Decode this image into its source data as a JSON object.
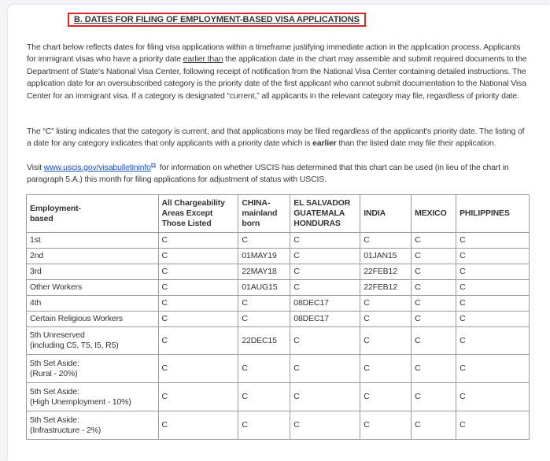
{
  "section_heading": "B.  DATES FOR FILING OF EMPLOYMENT-BASED VISA APPLICATIONS",
  "paragraph1": {
    "part1": "The chart below reflects dates for filing visa applications within a timeframe justifying immediate action in the application process. Applicants for immigrant visas who have a priority date ",
    "underlined": "earlier than",
    "part2": " the application date in the chart may assemble and submit required documents to the Department of State's National Visa Center, following receipt of notification from the National Visa Center containing detailed instructions. The application date for an oversubscribed category is the priority date of the first applicant who cannot submit documentation to the National Visa Center for an immigrant visa. If a category is designated “current,” all applicants in the relevant category may file, regardless of priority date."
  },
  "paragraph2": {
    "part1": "The “C” listing indicates that the category is current, and that applications may be filed regardless of the applicant's priority date. The listing of a date for any category indicates that only applicants with a priority date which is ",
    "bold": "earlier",
    "part2": " than the listed date may file their application."
  },
  "paragraph3": {
    "part1": "Visit ",
    "link": "www.uscis.gov/visabulletininfo",
    "part2": " for information on whether USCIS has determined that this chart can be used (in lieu of the chart in paragraph 5.A.) this month for filing applications for adjustment of status with USCIS."
  },
  "table": {
    "headers": [
      "Employment-\nbased",
      "All Chargeability\nAreas Except\nThose Listed",
      "CHINA-\nmainland\nborn",
      "EL SALVADOR\nGUATEMALA\nHONDURAS",
      "INDIA",
      "MEXICO",
      "PHILIPPINES"
    ],
    "rows": [
      [
        "1st",
        "C",
        "C",
        "C",
        "C",
        "C",
        "C"
      ],
      [
        "2nd",
        "C",
        "01MAY19",
        "C",
        "01JAN15",
        "C",
        "C"
      ],
      [
        "3rd",
        "C",
        "22MAY18",
        "C",
        "22FEB12",
        "C",
        "C"
      ],
      [
        "Other Workers",
        "C",
        "01AUG15",
        "C",
        "22FEB12",
        "C",
        "C"
      ],
      [
        "4th",
        "C",
        "C",
        "08DEC17",
        "C",
        "C",
        "C"
      ],
      [
        "Certain Religious Workers",
        "C",
        "C",
        "08DEC17",
        "C",
        "C",
        "C"
      ],
      [
        "5th Unreserved\n(including C5, T5, I5, R5)",
        "C",
        "22DEC15",
        "C",
        "C",
        "C",
        "C"
      ],
      [
        "5th Set Aside:\n(Rural - 20%)",
        "C",
        "C",
        "C",
        "C",
        "C",
        "C"
      ],
      [
        "5th Set Aside:\n(High Unemployment - 10%)",
        "C",
        "C",
        "C",
        "C",
        "C",
        "C"
      ],
      [
        "5th Set Aside:\n(Infrastructure - 2%)",
        "C",
        "C",
        "C",
        "C",
        "C",
        "C"
      ]
    ]
  },
  "colors": {
    "heading_border": "#e02323",
    "link": "#1a4fb8",
    "table_border": "#9c9c9c"
  },
  "icons": {
    "external_link": "external-link-icon"
  }
}
